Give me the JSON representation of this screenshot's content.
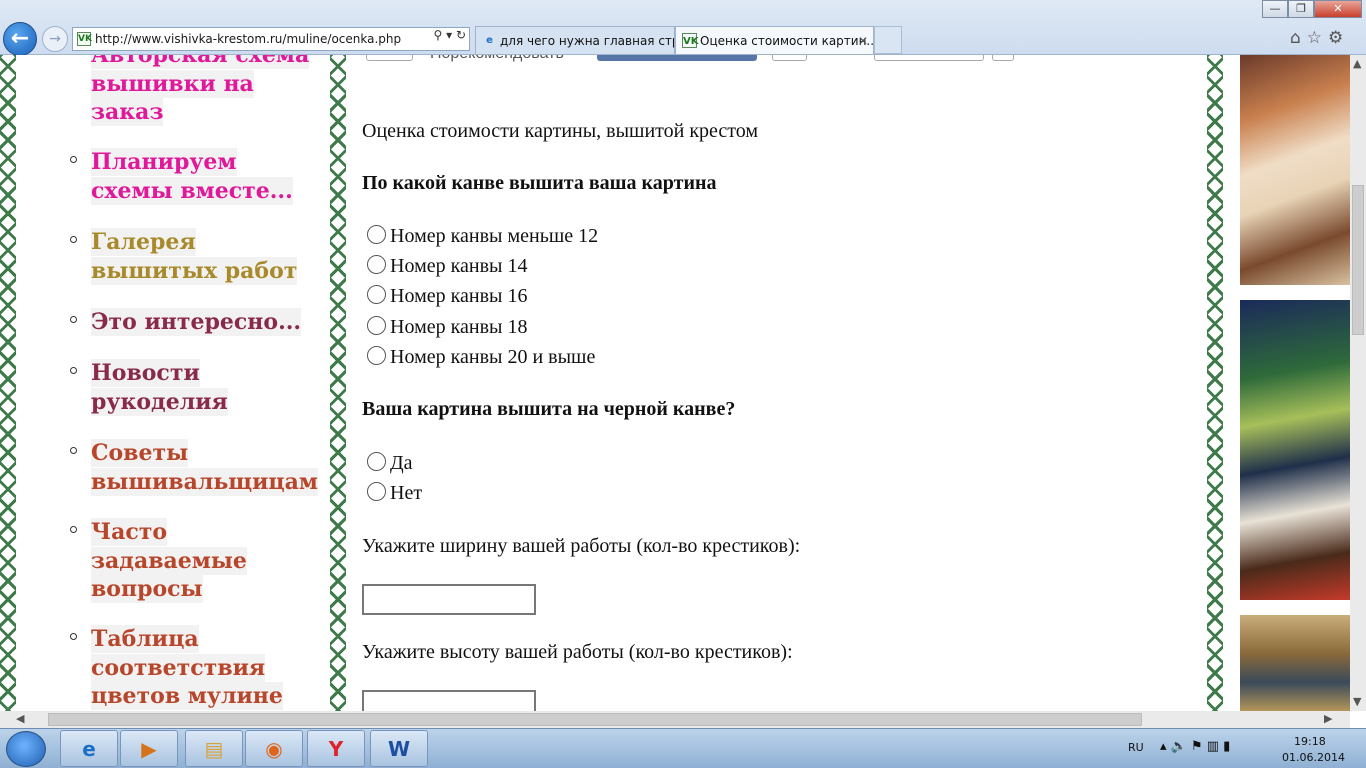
{
  "browser": {
    "address": "http://www.vishivka-krestom.ru/muline/ocenka.php",
    "favicon_text": "VK",
    "tabs": [
      {
        "title": "для чего нужна главная стра...",
        "icon": "ie-page-icon"
      },
      {
        "title": "Оценка стоимости картин...",
        "icon": "vk-site-icon"
      }
    ],
    "window_buttons": {
      "minimize": "—",
      "maximize": "❐",
      "close": "✕"
    }
  },
  "top_partial": {
    "recommend": "Порекомендовать"
  },
  "menu": {
    "items": [
      {
        "label": "Авторская схема",
        "label2": "вышивки на",
        "label3": "заказ",
        "color": "#e0189a"
      },
      {
        "label": "Планируем",
        "label2": "схемы вместе...",
        "color": "#e0189a"
      },
      {
        "label": "Галерея",
        "label2": "вышитых работ",
        "color": "#a88a2a"
      },
      {
        "label": "Это интересно...",
        "color": "#8a2a4a"
      },
      {
        "label": "Новости",
        "label2": "рукоделия",
        "color": "#8a2a4a"
      },
      {
        "label": "Советы",
        "label2": "вышивальщицам",
        "color": "#b8462a"
      },
      {
        "label": "Часто",
        "label2": "задаваемые",
        "label3": "вопросы",
        "color": "#b8462a"
      },
      {
        "label": "Таблица",
        "label2": "соответствия",
        "label3": "цветов мулине",
        "color": "#b8462a"
      }
    ]
  },
  "form": {
    "title": "Оценка стоимости картины, вышитой крестом",
    "q1": "По какой канве вышита ваша картина",
    "q1_options": [
      "Номер канвы меньше 12",
      "Номер канвы 14",
      "Номер канвы 16",
      "Номер канвы 18",
      "Номер канвы 20 и выше"
    ],
    "q2": "Ваша картина вышита на черной канве?",
    "q2_options": [
      "Да",
      "Нет"
    ],
    "width_label": "Укажите ширину вашей работы (кол-во крестиков):",
    "height_label": "Укажите высоту вашей работы (кол-во крестиков):",
    "width_value": "",
    "height_value": ""
  },
  "taskbar": {
    "apps": [
      "ie-icon",
      "media-player-icon",
      "explorer-icon",
      "firefox-icon",
      "yandex-icon",
      "word-icon"
    ],
    "lang": "RU",
    "time": "19:18",
    "date": "01.06.2014"
  }
}
